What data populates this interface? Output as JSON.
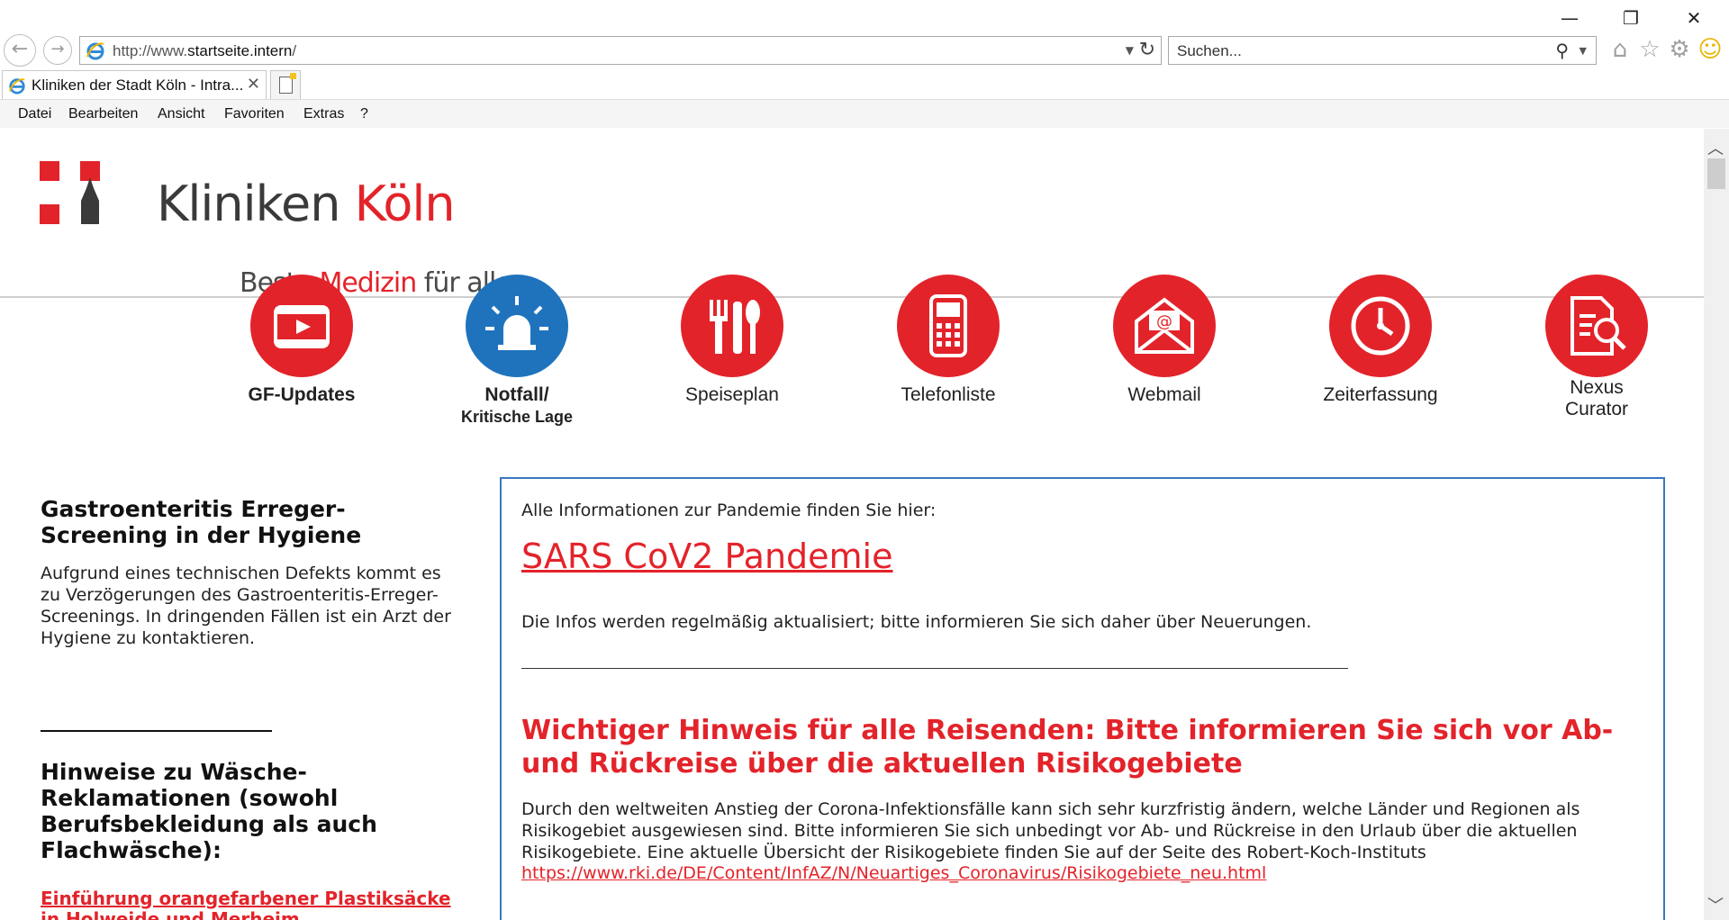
{
  "window": {
    "minimize": "—",
    "restore": "❐",
    "close": "✕"
  },
  "address_bar": {
    "url_prefix": "http://www.",
    "url_host": "startseite.intern",
    "url_suffix": "/"
  },
  "search_bar": {
    "placeholder": "Suchen..."
  },
  "tab": {
    "title": "Kliniken der Stadt Köln - Intra..."
  },
  "menu": {
    "items": [
      "Datei",
      "Bearbeiten",
      "Ansicht",
      "Favoriten",
      "Extras",
      "?"
    ]
  },
  "logo": {
    "name_part1": "Kliniken ",
    "name_part2": "Köln",
    "slogan_part1": "Beste ",
    "slogan_part2": "Medizin",
    "slogan_part3": " für alle."
  },
  "quick_links": [
    {
      "label_line1": "GF-Updates",
      "label_line2": "",
      "icon": "video-icon",
      "color": "#e3232a"
    },
    {
      "label_line1": "Notfall/",
      "label_line2": "Kritische Lage",
      "icon": "alarm-light-icon",
      "color": "#1f73bd"
    },
    {
      "label_line1": "Speiseplan",
      "label_line2": "",
      "icon": "cutlery-icon",
      "color": "#e3232a"
    },
    {
      "label_line1": "Telefonliste",
      "label_line2": "",
      "icon": "phone-icon",
      "color": "#e3232a"
    },
    {
      "label_line1": "Webmail",
      "label_line2": "",
      "icon": "mail-icon",
      "color": "#e3232a"
    },
    {
      "label_line1": "Zeiterfassung",
      "label_line2": "",
      "icon": "clock-icon",
      "color": "#e3232a"
    },
    {
      "label_line1": "Nexus",
      "label_line2": "Curator",
      "icon": "document-search-icon",
      "color": "#e3232a"
    }
  ],
  "left_column": {
    "news1_title": "Gastroenteritis Erreger-Screening in der Hygiene",
    "news1_text": "Aufgrund eines technischen Defekts kommt es zu Verzögerungen des Gastroenteritis-Erreger-Screenings. In dringenden Fällen ist ein Arzt der Hygiene zu kontaktieren.",
    "news2_title": "Hinweise zu Wäsche-Reklamationen (sowohl Berufsbekleidung als auch Flachwäsche):",
    "news2_link": "Einführung orangefarbener Plastiksäcke in Holweide und Merheim"
  },
  "main_box": {
    "intro": "Alle Informationen zur Pandemie finden Sie hier:",
    "big_link": "SARS CoV2 Pandemie",
    "note": "Die Infos werden regelmäßig aktualisiert; bitte informieren Sie sich daher über Neuerungen.",
    "heading": "Wichtiger Hinweis für alle Reisenden: Bitte informieren Sie sich vor Ab- und Rückreise über die aktuellen Risikogebiete",
    "body": "Durch den weltweiten Anstieg der Corona-Infektionsfälle kann sich sehr kurzfristig ändern, welche Länder und Regionen als Risikogebiet ausgewiesen sind.  Bitte informieren Sie sich unbedingt vor Ab- und Rückreise in den Urlaub über die aktuellen Risikogebiete. Eine aktuelle Übersicht der Risikogebiete finden Sie auf der Seite des Robert-Koch-Instituts",
    "url": "https://www.rki.de/DE/Content/InfAZ/N/Neuartiges_Coronavirus/Risikogebiete_neu.html"
  },
  "colors": {
    "brand_red": "#e3232a",
    "emergency_blue": "#1f73bd",
    "box_border": "#3a78bd"
  }
}
